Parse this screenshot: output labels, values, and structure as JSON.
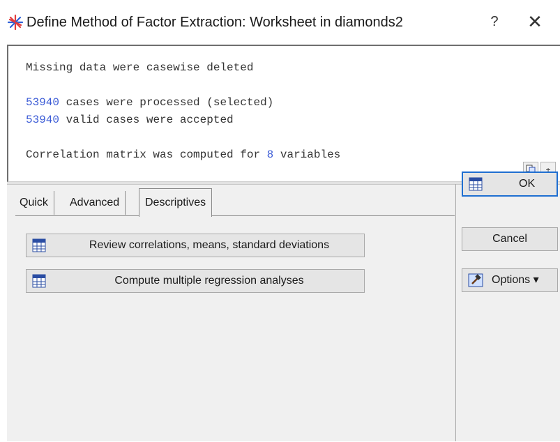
{
  "window": {
    "title": "Define Method of Factor Extraction: Worksheet in diamonds2",
    "help_glyph": "?",
    "close_glyph": "✕",
    "icon": "asterisk-star-icon"
  },
  "output": {
    "line1": "Missing data were casewise deleted",
    "line2_num": "53940",
    "line2_text": " cases were processed (selected)",
    "line3_num": "53940",
    "line3_text": " valid cases were accepted",
    "line4_pre": "Correlation matrix was computed for ",
    "line4_num": "8",
    "line4_post": " variables",
    "copy_icon": "copy-icon",
    "expand_glyph": "±"
  },
  "tabs": [
    {
      "label": "Quick"
    },
    {
      "label": "Advanced"
    },
    {
      "label": "Descriptives",
      "active": true
    }
  ],
  "descriptives": {
    "review_label": "Review correlations, means, standard deviations",
    "regression_label": "Compute multiple regression analyses"
  },
  "side": {
    "ok_label": "OK",
    "cancel_label": "Cancel",
    "options_label": "Options ▾"
  },
  "colors": {
    "accent_number": "#3b5bd6",
    "focus_border": "#1f6fd1",
    "panel_bg": "#f0f0f0"
  }
}
